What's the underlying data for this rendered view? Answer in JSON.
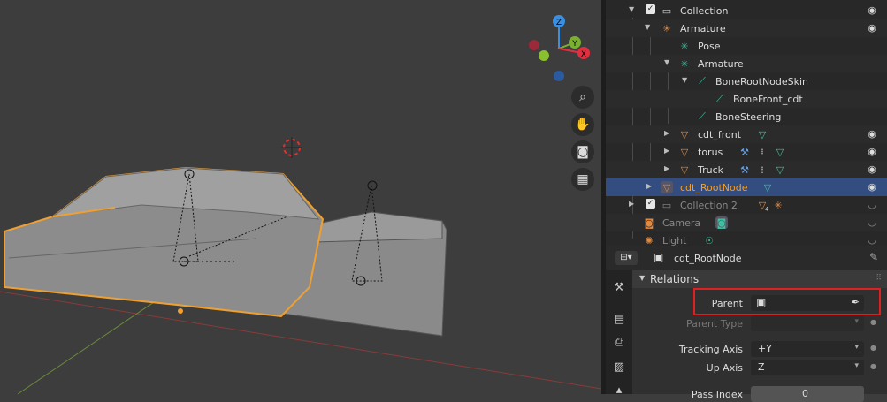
{
  "outliner": {
    "rows": [
      {
        "label": "Collection"
      },
      {
        "label": "Armature"
      },
      {
        "label": "Pose"
      },
      {
        "label": "Armature"
      },
      {
        "label": "BoneRootNodeSkin"
      },
      {
        "label": "BoneFront_cdt"
      },
      {
        "label": "BoneSteering"
      },
      {
        "label": "cdt_front"
      },
      {
        "label": "torus"
      },
      {
        "label": "Truck"
      },
      {
        "label": "cdt_RootNode"
      },
      {
        "label": "Collection 2"
      },
      {
        "label": "Camera"
      },
      {
        "label": "Light"
      }
    ],
    "badge_count": "4"
  },
  "properties": {
    "object_name": "cdt_RootNode",
    "panel_title": "Relations",
    "parent_label": "Parent",
    "parent_type_label": "Parent Type",
    "tracking_axis_label": "Tracking Axis",
    "tracking_axis_value": "+Y",
    "up_axis_label": "Up Axis",
    "up_axis_value": "Z",
    "pass_index_label": "Pass Index",
    "pass_index_value": "0"
  },
  "gizmo": {
    "z": "Z",
    "y": "Y",
    "x": "X"
  },
  "colors": {
    "selection": "#334d80",
    "highlight_box": "#e02020",
    "object_outline": "#f0a030"
  }
}
